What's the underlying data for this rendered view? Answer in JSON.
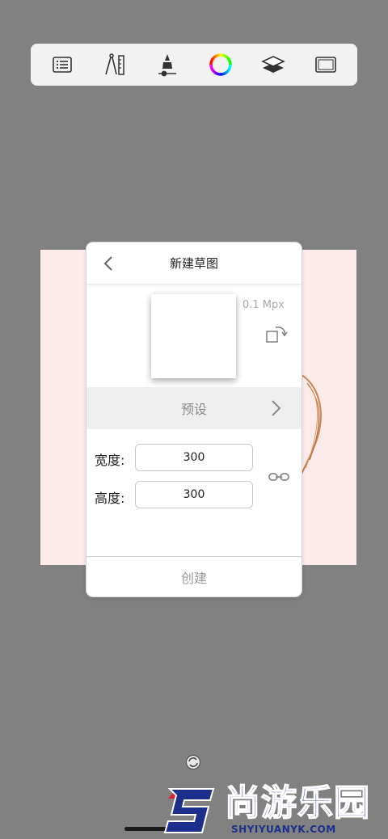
{
  "toolbar": {
    "tools": [
      {
        "icon": "list-icon"
      },
      {
        "icon": "ruler-compass-icon"
      },
      {
        "icon": "brush-icon"
      },
      {
        "icon": "color-wheel-icon"
      },
      {
        "icon": "layers-icon"
      },
      {
        "icon": "fullscreen-icon"
      }
    ]
  },
  "dialog": {
    "title": "新建草图",
    "megapixels": "0.1 Mpx",
    "preset_label": "预设",
    "width_label": "宽度:",
    "width_value": "300",
    "height_label": "高度:",
    "height_value": "300",
    "create_label": "创建"
  },
  "watermark": {
    "title": "尚游乐园",
    "subtitle": "SHYIYUANYK.COM"
  },
  "colors": {
    "background": "#818181",
    "canvas": "#fbebeb",
    "watermark_blue": "#1d2f8c",
    "watermark_red": "#e0203a"
  }
}
